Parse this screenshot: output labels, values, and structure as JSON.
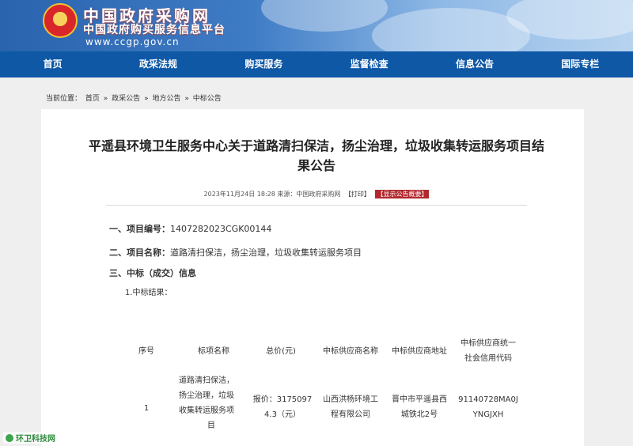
{
  "site": {
    "title": "中国政府采购网",
    "subtitle": "中国政府购买服务信息平台",
    "url": "www.ccgp.gov.cn"
  },
  "nav": [
    "首页",
    "政采法规",
    "购买服务",
    "监督检查",
    "信息公告",
    "国际专栏"
  ],
  "breadcrumb": {
    "prefix": "当前位置：",
    "items": [
      "首页",
      "政采公告",
      "地方公告",
      "中标公告"
    ],
    "sep": "»"
  },
  "article": {
    "title_line1": "平遥县环境卫生服务中心关于道路清扫保洁，扬尘治理，垃圾收集转运服务项目结",
    "title_line2": "果公告",
    "meta": "2023年11月24日 18:28 来源：中国政府采购网",
    "print_label": "【打印】",
    "summary_label": "【显示公告概要】",
    "project_no_label": "一、项目编号：",
    "project_no": "1407282023CGK00144",
    "project_name_label": "二、项目名称：",
    "project_name": "道路清扫保洁，扬尘治理，垃圾收集转运服务项目",
    "section3": "三、中标（成交）信息",
    "result_label": "1.中标结果："
  },
  "table": {
    "headers": [
      "序号",
      "标项名称",
      "总价(元)",
      "中标供应商名称",
      "中标供应商地址",
      "中标供应商统一",
      "社会信用代码"
    ],
    "row": {
      "no": "1",
      "name_lines": [
        "道路清扫保洁，",
        "扬尘治理，垃圾",
        "收集转运服务项",
        "目"
      ],
      "price_lines": [
        "报价：3175097",
        "4.3（元）"
      ],
      "supplier_lines": [
        "山西洪杨环境工",
        "程有限公司"
      ],
      "address_lines": [
        "晋中市平遥县西",
        "城铁北2号"
      ],
      "code_lines": [
        "91140728MA0J",
        "YNGJXH"
      ]
    }
  },
  "watermark": "环卫科技网"
}
